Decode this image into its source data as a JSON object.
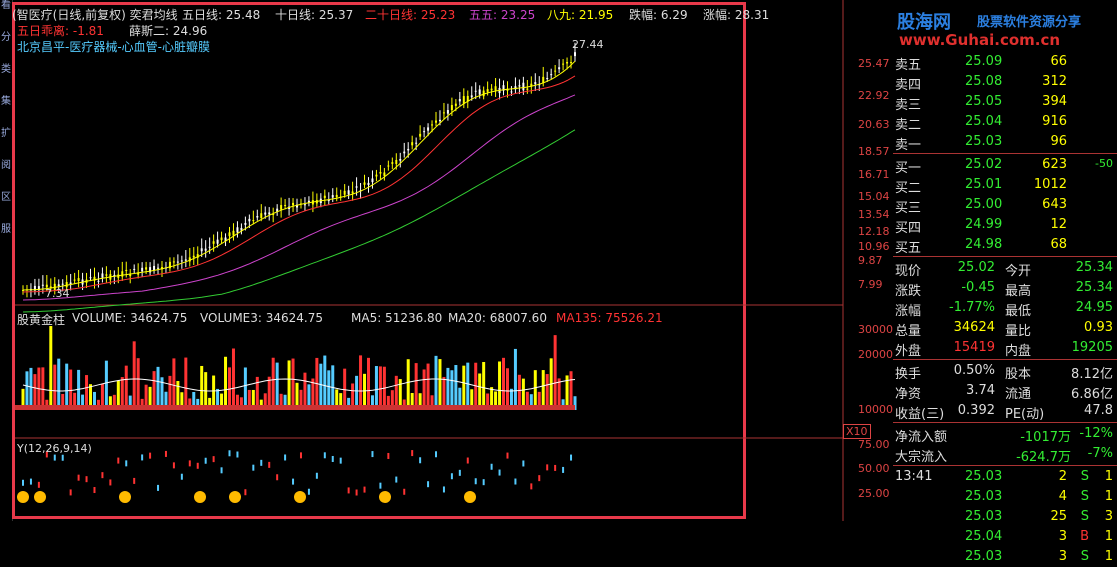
{
  "sidebar": [
    "看",
    "分",
    "类",
    "集",
    "扩",
    "阅",
    "区",
    "服"
  ],
  "chart_header": {
    "line1": [
      {
        "text": "(智医疗(日线,前复权) 奕君均线",
        "color": "#ddd"
      },
      {
        "text": "五日线: 25.48",
        "color": "#ddd"
      },
      {
        "text": "十日线: 25.37",
        "color": "#ddd"
      },
      {
        "text": "二十日线: 25.23",
        "color": "#f33"
      },
      {
        "text": "五五: 23.25",
        "color": "#c4c"
      },
      {
        "text": "八九: 21.95",
        "color": "#ff0"
      },
      {
        "text": "跌幅: 6.29",
        "color": "#ddd"
      },
      {
        "text": "涨幅: 28.31",
        "color": "#ddd"
      }
    ],
    "line2": [
      {
        "text": "五日乖离: -1.81",
        "color": "#f33"
      },
      {
        "text": "薛斯二: 24.96",
        "color": "#ddd"
      }
    ],
    "concept": "北京昌平-医疗器械-心血管-心脏瓣膜",
    "high_label": "27.44",
    "low_label": "7.34"
  },
  "price_axis": [
    "25.47",
    "22.92",
    "20.63",
    "18.57",
    "16.71",
    "15.04",
    "13.54",
    "12.18",
    "10.96",
    "9.87",
    "7.99"
  ],
  "volume_header": [
    {
      "text": "股黄金柱",
      "color": "#ddd"
    },
    {
      "text": "VOLUME: 34624.75",
      "color": "#ddd"
    },
    {
      "text": "VOLUME3: 34624.75",
      "color": "#ddd"
    },
    {
      "text": "MA5: 51236.80",
      "color": "#ddd"
    },
    {
      "text": "MA20: 68007.60",
      "color": "#ddd"
    },
    {
      "text": "MA135: 75526.21",
      "color": "#f33"
    }
  ],
  "volume_axis": [
    "30000",
    "20000",
    "10000"
  ],
  "volume_unit": "X10",
  "indicator_header": "Y(12,26,9,14)",
  "indicator_axis": [
    "75.00",
    "50.00",
    "25.00"
  ],
  "logo": {
    "cn": "股海网",
    "tag": "股票软件资源分享",
    "url": "www.Guhai.com.cn"
  },
  "order_book": {
    "asks": [
      {
        "label": "卖五",
        "price": "25.09",
        "vol": "66"
      },
      {
        "label": "卖四",
        "price": "25.08",
        "vol": "312"
      },
      {
        "label": "卖三",
        "price": "25.05",
        "vol": "394"
      },
      {
        "label": "卖二",
        "price": "25.04",
        "vol": "916"
      },
      {
        "label": "卖一",
        "price": "25.03",
        "vol": "96"
      }
    ],
    "bids": [
      {
        "label": "买一",
        "price": "25.02",
        "vol": "623",
        "chg": "-50"
      },
      {
        "label": "买二",
        "price": "25.01",
        "vol": "1012",
        "chg": ""
      },
      {
        "label": "买三",
        "price": "25.00",
        "vol": "643",
        "chg": ""
      },
      {
        "label": "买四",
        "price": "24.99",
        "vol": "12",
        "chg": ""
      },
      {
        "label": "买五",
        "price": "24.98",
        "vol": "68",
        "chg": ""
      }
    ]
  },
  "quote": [
    {
      "l1": "现价",
      "v1": "25.02",
      "c1": "#3e3",
      "l2": "今开",
      "v2": "25.34",
      "c2": "#3e3"
    },
    {
      "l1": "涨跌",
      "v1": "-0.45",
      "c1": "#3e3",
      "l2": "最高",
      "v2": "25.34",
      "c2": "#3e3"
    },
    {
      "l1": "涨幅",
      "v1": "-1.77%",
      "c1": "#3e3",
      "l2": "最低",
      "v2": "24.95",
      "c2": "#3e3"
    },
    {
      "l1": "总量",
      "v1": "34624",
      "c1": "#ff0",
      "l2": "量比",
      "v2": "0.93",
      "c2": "#ff0"
    },
    {
      "l1": "外盘",
      "v1": "15419",
      "c1": "#f33",
      "l2": "内盘",
      "v2": "19205",
      "c2": "#3e3"
    }
  ],
  "fundamentals": [
    {
      "l1": "换手",
      "v1": "0.50%",
      "l2": "股本",
      "v2": "8.12亿"
    },
    {
      "l1": "净资",
      "v1": "3.74",
      "l2": "流通",
      "v2": "6.86亿"
    },
    {
      "l1": "收益(三)",
      "v1": "0.392",
      "l2": "PE(动)",
      "v2": "47.8"
    }
  ],
  "flows": [
    {
      "label": "净流入额",
      "value": "-1017万",
      "pct": "-12%"
    },
    {
      "label": "大宗流入",
      "value": "-624.7万",
      "pct": "-7%"
    }
  ],
  "ticks": [
    {
      "time": "13:41",
      "price": "25.03",
      "vol": "2",
      "side": "S",
      "n": "1"
    },
    {
      "time": "",
      "price": "25.03",
      "vol": "4",
      "side": "S",
      "n": "1"
    },
    {
      "time": "",
      "price": "25.03",
      "vol": "25",
      "side": "S",
      "n": "3"
    },
    {
      "time": "",
      "price": "25.04",
      "vol": "3",
      "side": "B",
      "n": "1"
    },
    {
      "time": "",
      "price": "25.03",
      "vol": "3",
      "side": "S",
      "n": "1"
    }
  ],
  "colors": {
    "frame": "#e8394a",
    "up": "#f33",
    "down": "#3e3",
    "vol": "#ff0"
  }
}
